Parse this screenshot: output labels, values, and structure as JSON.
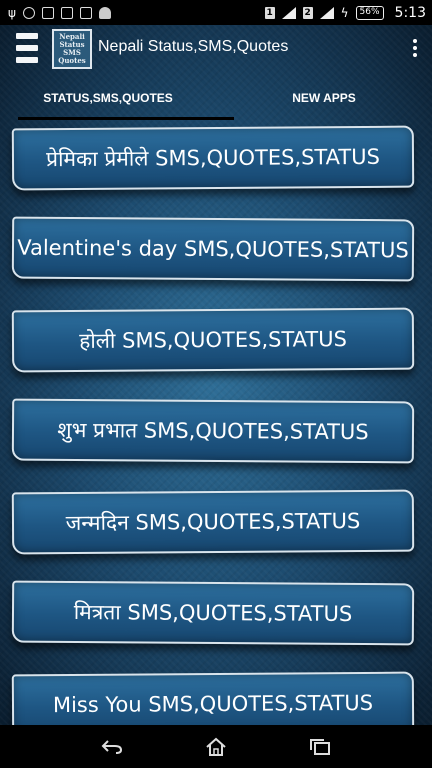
{
  "status_bar": {
    "sim1": "1",
    "sim2": "2",
    "battery": "56%",
    "time": "5:13"
  },
  "toolbar": {
    "logo_text": "Nepali Status SMS Quotes",
    "title": "Nepali Status,SMS,Quotes"
  },
  "tabs": [
    {
      "label": "STATUS,SMS,QUOTES",
      "selected": true
    },
    {
      "label": "NEW APPS",
      "selected": false
    }
  ],
  "list": {
    "items": [
      {
        "label": "प्रेमिका प्रेमीले SMS,QUOTES,STATUS"
      },
      {
        "label": "Valentine's day SMS,QUOTES,STATUS"
      },
      {
        "label": "होली SMS,QUOTES,STATUS"
      },
      {
        "label": "शुभ प्रभात SMS,QUOTES,STATUS"
      },
      {
        "label": "जन्मदिन SMS,QUOTES,STATUS"
      },
      {
        "label": "मित्रता SMS,QUOTES,STATUS"
      },
      {
        "label": "Miss You SMS,QUOTES,STATUS"
      }
    ]
  },
  "nav": {
    "back_icon": "back-icon",
    "home_icon": "home-icon",
    "recents_icon": "recents-icon"
  },
  "colors": {
    "item_bg": "#1e5683",
    "item_border": "#d9e4ec",
    "status_bg": "#000000"
  }
}
